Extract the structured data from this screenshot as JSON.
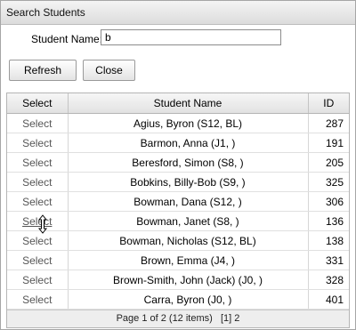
{
  "window": {
    "title": "Search Students"
  },
  "search": {
    "label": "Student Name:",
    "value": "b"
  },
  "buttons": {
    "refresh": "Refresh",
    "close": "Close"
  },
  "table": {
    "headers": [
      "Select",
      "Student Name",
      "ID"
    ],
    "rows": [
      {
        "select": "Select",
        "name": "Agius, Byron (S12, BL)",
        "id": "287"
      },
      {
        "select": "Select",
        "name": "Barmon, Anna (J1, )",
        "id": "191"
      },
      {
        "select": "Select",
        "name": "Beresford, Simon (S8, )",
        "id": "205"
      },
      {
        "select": "Select",
        "name": "Bobkins, Billy-Bob (S9, )",
        "id": "325"
      },
      {
        "select": "Select",
        "name": "Bowman, Dana (S12, )",
        "id": "306"
      },
      {
        "select": "Select",
        "name": "Bowman, Janet (S8, )",
        "id": "136"
      },
      {
        "select": "Select",
        "name": "Bowman, Nicholas (S12, BL)",
        "id": "138"
      },
      {
        "select": "Select",
        "name": "Brown, Emma (J4, )",
        "id": "331"
      },
      {
        "select": "Select",
        "name": "Brown-Smith, John (Jack) (J0, )",
        "id": "328"
      },
      {
        "select": "Select",
        "name": "Carra, Byron (J0, )",
        "id": "401"
      }
    ]
  },
  "pager": {
    "text": "Page 1 of 2 (12 items)",
    "current": "[1]",
    "next": "2"
  },
  "icons": {
    "cursor": "move-cursor-icon"
  }
}
